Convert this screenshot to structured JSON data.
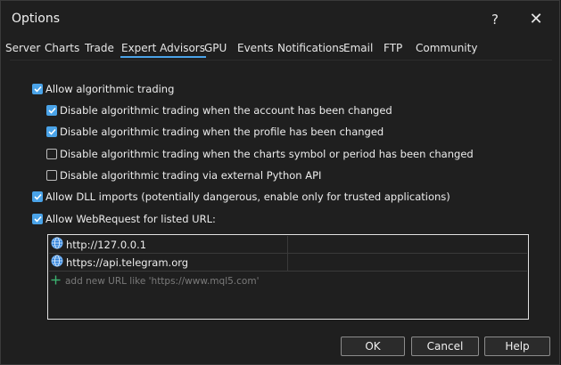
{
  "window": {
    "title": "Options",
    "help_glyph": "?",
    "close_glyph": "✕"
  },
  "tabs": [
    {
      "label": "Server",
      "active": false
    },
    {
      "label": "Charts",
      "active": false
    },
    {
      "label": "Trade",
      "active": false
    },
    {
      "label": "Expert Advisors",
      "active": true
    },
    {
      "label": "GPU",
      "active": false
    },
    {
      "label": "Events",
      "active": false
    },
    {
      "label": "Notifications",
      "active": false
    },
    {
      "label": "Email",
      "active": false
    },
    {
      "label": "FTP",
      "active": false
    },
    {
      "label": "Community",
      "active": false
    }
  ],
  "options": {
    "allow_algo": {
      "label": "Allow algorithmic trading",
      "checked": true
    },
    "disable_account": {
      "label": "Disable algorithmic trading when the account has been changed",
      "checked": true
    },
    "disable_profile": {
      "label": "Disable algorithmic trading when the profile has been changed",
      "checked": true
    },
    "disable_symbol": {
      "label": "Disable algorithmic trading when the charts symbol or period has been changed",
      "checked": false
    },
    "disable_python": {
      "label": "Disable algorithmic trading via external Python API",
      "checked": false
    },
    "allow_dll": {
      "label": "Allow DLL imports (potentially dangerous, enable only for trusted applications)",
      "checked": true
    },
    "allow_webrequest": {
      "label": "Allow WebRequest for listed URL:",
      "checked": true
    }
  },
  "urls": {
    "items": [
      {
        "url": "http://127.0.0.1",
        "icon": "globe-icon"
      },
      {
        "url": "https://api.telegram.org",
        "icon": "globe-icon"
      }
    ],
    "add_placeholder": "add new URL like 'https://www.mql5.com'",
    "add_icon": "plus-icon"
  },
  "buttons": {
    "ok": "OK",
    "cancel": "Cancel",
    "help": "Help"
  },
  "colors": {
    "accent": "#4aa3e8",
    "background": "#1f1f1f",
    "add_icon": "#3cb371"
  }
}
